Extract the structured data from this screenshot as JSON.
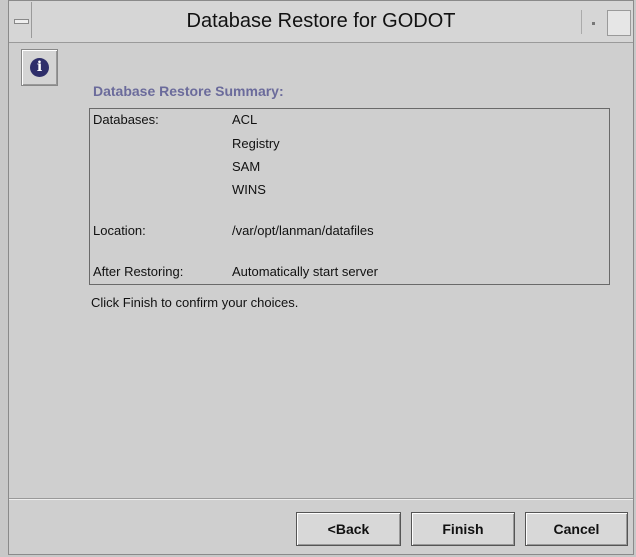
{
  "window": {
    "title": "Database Restore for GODOT"
  },
  "icons": {
    "info": "info-icon",
    "info_glyph": "i"
  },
  "summary": {
    "heading": "Database Restore Summary:",
    "databases_label": "Databases:",
    "databases": [
      "ACL",
      "Registry",
      "SAM",
      "WINS"
    ],
    "location_label": "Location:",
    "location_value": "/var/opt/lanman/datafiles",
    "after_label": "After Restoring:",
    "after_value": "Automatically start server"
  },
  "prompt": "Click Finish to confirm your choices.",
  "buttons": {
    "back": "<Back",
    "finish": "Finish",
    "cancel": "Cancel"
  }
}
